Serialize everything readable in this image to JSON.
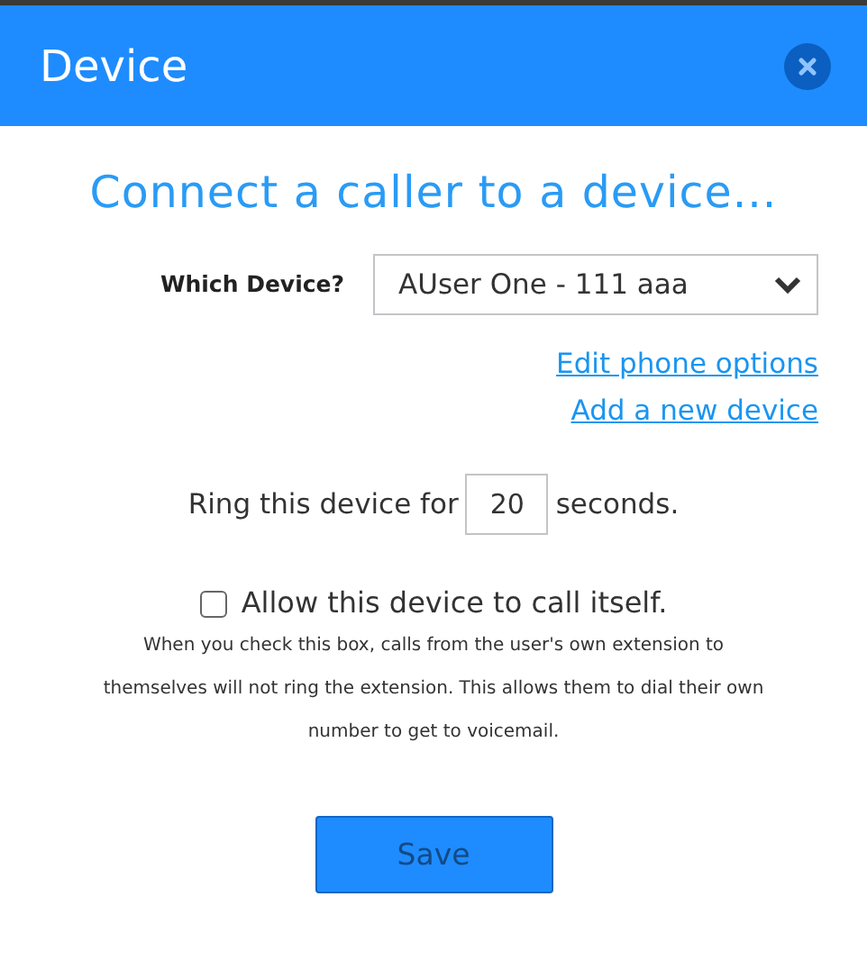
{
  "window": {
    "title": "Device"
  },
  "heading": "Connect a caller to a device...",
  "device": {
    "label": "Which Device?",
    "value": "AUser One - 111 aaa"
  },
  "links": [
    "Edit phone options",
    "Add a new device"
  ],
  "ring": {
    "before": "Ring this device for",
    "value": "20",
    "after": "seconds."
  },
  "allow_self_call": {
    "label": "Allow this device to call itself.",
    "checked": false,
    "note": "When you check this box, calls from the user's own extension to themselves will not ring the extension. This allows them to dial their own number to get to voicemail."
  },
  "buttons": [
    "Save"
  ]
}
